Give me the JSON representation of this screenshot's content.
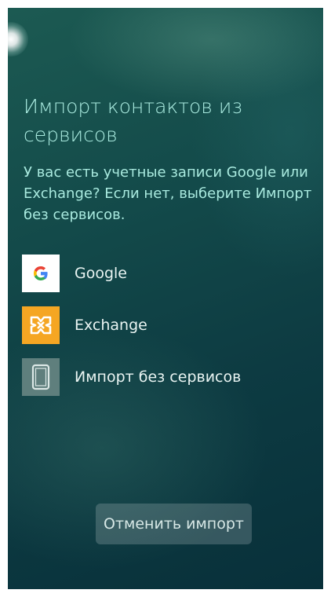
{
  "header": {
    "title": "Импорт контактов из сервисов",
    "description": "У вас есть учетные записи Google или Exchange? Если нет, выберите Импорт без сервисов."
  },
  "options": [
    {
      "label": "Google",
      "icon": "google-icon"
    },
    {
      "label": "Exchange",
      "icon": "exchange-icon"
    },
    {
      "label": "Импорт без сервисов",
      "icon": "device-icon"
    }
  ],
  "actions": {
    "cancel_label": "Отменить импорт"
  },
  "colors": {
    "title_text": "#a9eadf",
    "item_text": "#e9f4f2",
    "background_top": "#1c5a52",
    "background_bottom": "#08303a",
    "exchange_orange": "#f5a623",
    "google_blue": "#4285F4",
    "google_red": "#EA4335",
    "google_yellow": "#FBBC05",
    "google_green": "#34A853"
  }
}
